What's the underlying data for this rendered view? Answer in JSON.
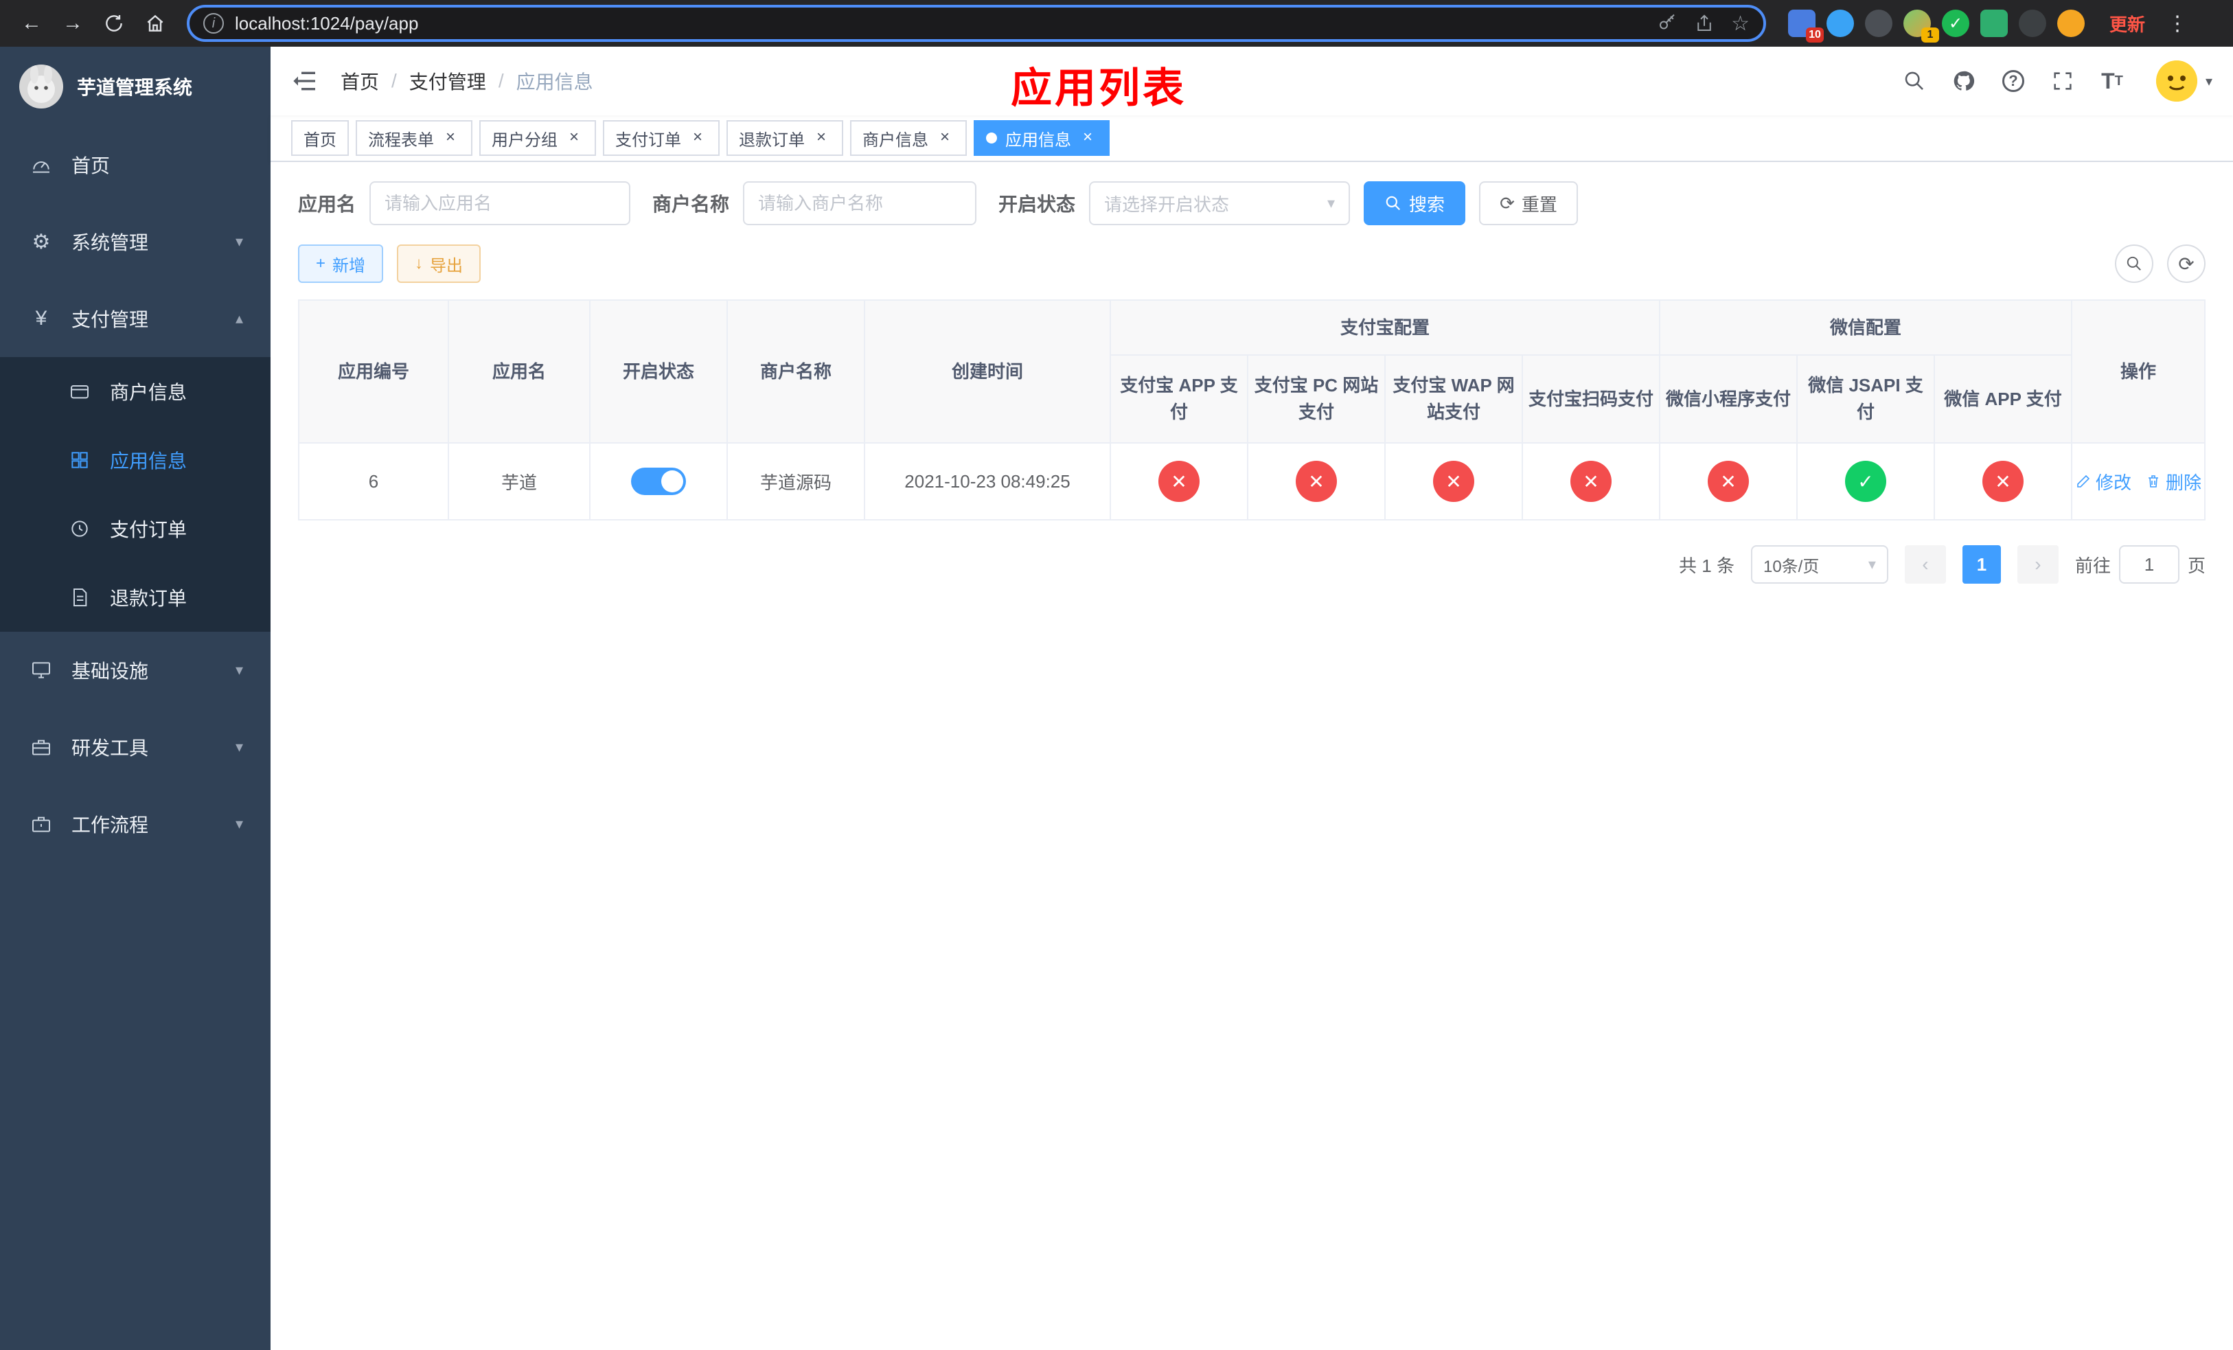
{
  "browser": {
    "url": "localhost:1024/pay/app",
    "update_label": "更新",
    "ext_badge_1": "10",
    "ext_badge_2": "1"
  },
  "icons": {
    "back": "←",
    "forward": "→",
    "close": "×",
    "check": "✓",
    "cross": "✕",
    "chevron_down": "▾",
    "chevron_up": "▴",
    "caret_down": "▾",
    "plus": "+",
    "download": "↓",
    "dots": "⋮",
    "prev": "‹",
    "next": "›",
    "slash": "/",
    "star": "☆",
    "info": "i",
    "question": "?",
    "refresh": "⟳",
    "font_large": "T",
    "font_small": "T",
    "yen": "¥",
    "gear": "⚙",
    "ext_check": "✓"
  },
  "sidebar": {
    "title": "芋道管理系统",
    "items": [
      {
        "label": "首页"
      },
      {
        "label": "系统管理"
      },
      {
        "label": "支付管理",
        "expanded": true
      },
      {
        "label": "基础设施"
      },
      {
        "label": "研发工具"
      },
      {
        "label": "工作流程"
      }
    ],
    "payment_submenu": [
      {
        "label": "商户信息",
        "active": false
      },
      {
        "label": "应用信息",
        "active": true
      },
      {
        "label": "支付订单",
        "active": false
      },
      {
        "label": "退款订单",
        "active": false
      }
    ]
  },
  "header": {
    "breadcrumb": [
      "首页",
      "支付管理",
      "应用信息"
    ],
    "annotation": "应用列表"
  },
  "tabs": [
    {
      "label": "首页",
      "closable": false,
      "active": false
    },
    {
      "label": "流程表单",
      "closable": true,
      "active": false
    },
    {
      "label": "用户分组",
      "closable": true,
      "active": false
    },
    {
      "label": "支付订单",
      "closable": true,
      "active": false
    },
    {
      "label": "退款订单",
      "closable": true,
      "active": false
    },
    {
      "label": "商户信息",
      "closable": true,
      "active": false
    },
    {
      "label": "应用信息",
      "closable": true,
      "active": true
    }
  ],
  "filters": {
    "app_name_label": "应用名",
    "app_name_placeholder": "请输入应用名",
    "merchant_label": "商户名称",
    "merchant_placeholder": "请输入商户名称",
    "status_label": "开启状态",
    "status_placeholder": "请选择开启状态",
    "search_label": "搜索",
    "reset_label": "重置"
  },
  "toolbar": {
    "add_label": "新增",
    "export_label": "导出"
  },
  "table": {
    "columns": [
      "应用编号",
      "应用名",
      "开启状态",
      "商户名称",
      "创建时间",
      "操作"
    ],
    "groups": [
      {
        "label": "支付宝配置",
        "children": [
          "支付宝 APP 支付",
          "支付宝 PC 网站支付",
          "支付宝 WAP 网站支付",
          "支付宝扫码支付"
        ]
      },
      {
        "label": "微信配置",
        "children": [
          "微信小程序支付",
          "微信 JSAPI 支付",
          "微信 APP 支付"
        ]
      }
    ],
    "rows": [
      {
        "id": "6",
        "name": "芋道",
        "enabled": true,
        "merchant": "芋道源码",
        "created": "2021-10-23 08:49:25",
        "configs": [
          false,
          false,
          false,
          false,
          false,
          true,
          false
        ],
        "edit_label": "修改",
        "delete_label": "删除"
      }
    ]
  },
  "pagination": {
    "total_label": "共 1 条",
    "per_page": "10条/页",
    "page": "1",
    "goto_label": "前往",
    "goto_value": "1",
    "page_suffix": "页"
  },
  "colors": {
    "accent": "#409eff",
    "sidebar_bg": "#304156",
    "submenu_bg": "#1f2d3d",
    "status_off_red": "#f34d4d",
    "status_on_green": "#13ce66",
    "annotation_red": "#ff0000"
  }
}
